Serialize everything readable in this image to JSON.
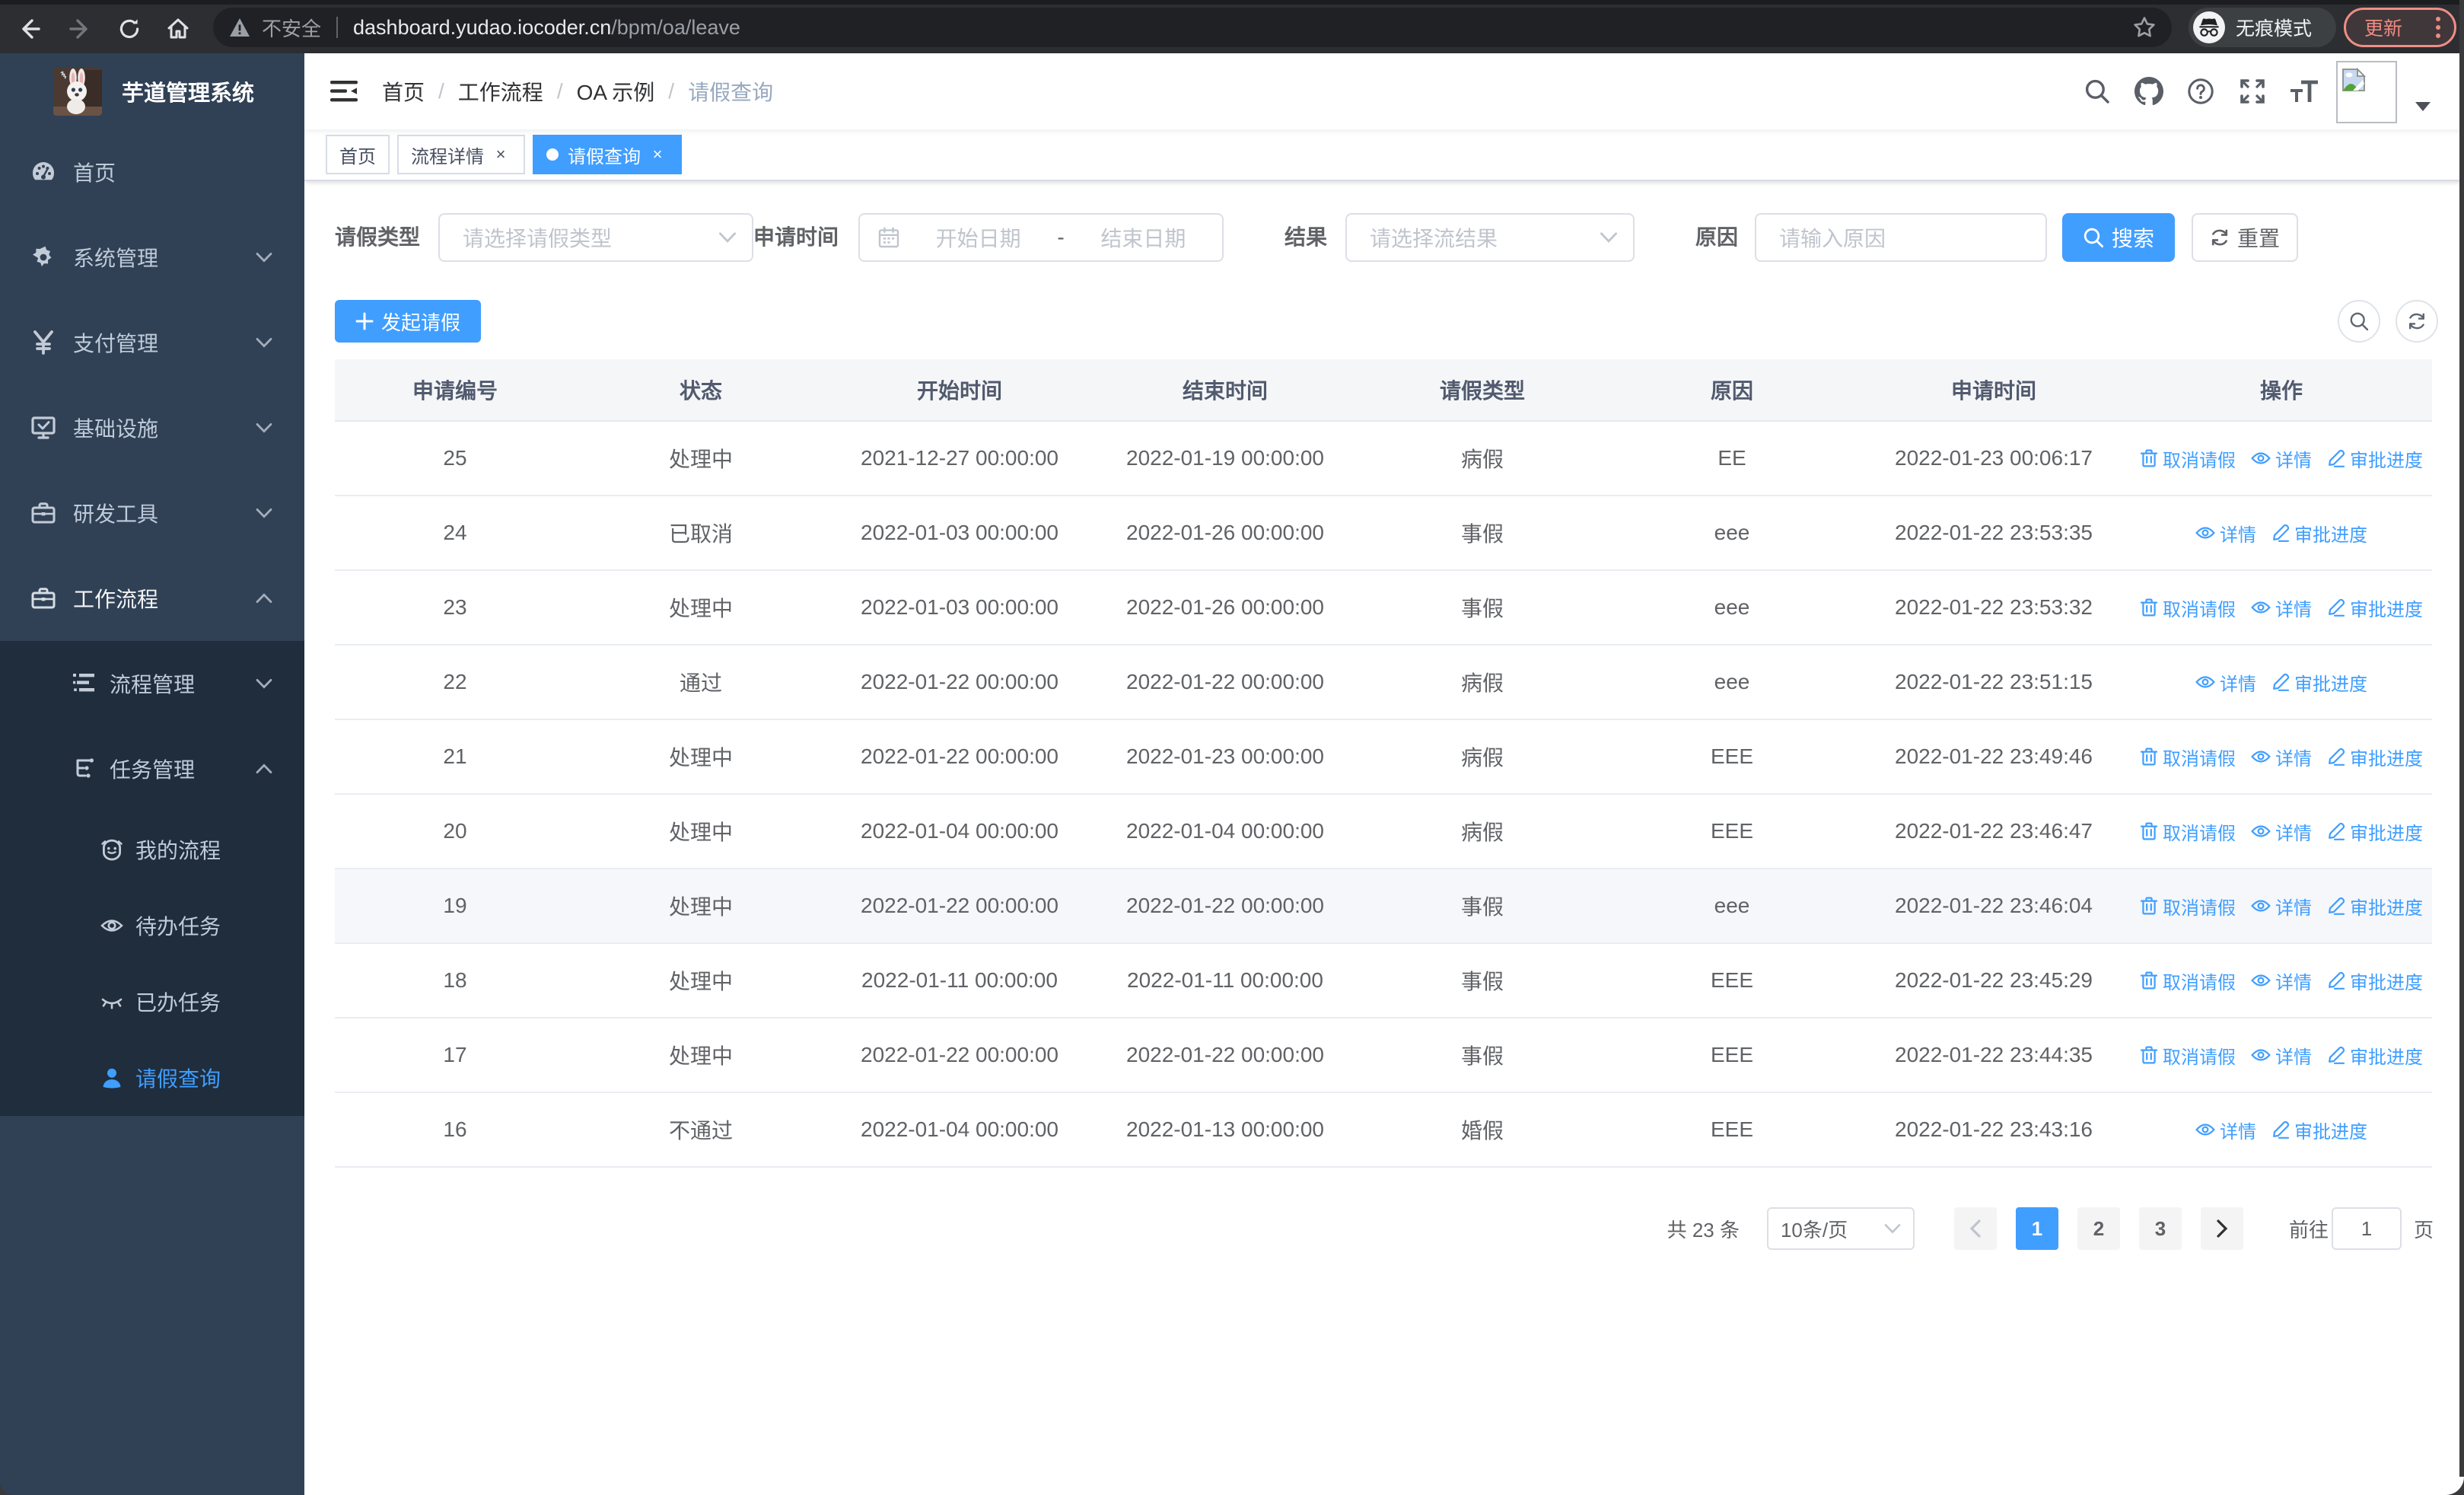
{
  "colors": {
    "accent": "#409eff",
    "sidebar_bg": "#304156",
    "submenu_bg": "#1f2d3d",
    "sidebar_text": "#bfcbd9",
    "chrome_bg": "#2d2e31",
    "omnibox_bg": "#202124",
    "update_accent": "#f08b82",
    "table_header_bg": "#f5f6f8",
    "hover_row_bg": "#f5f7fa"
  },
  "browser": {
    "security_label": "不安全",
    "url_host": "dashboard.yudao.iocoder.cn",
    "url_path": "/bpm/oa/leave",
    "incognito_label": "无痕模式",
    "update_label": "更新"
  },
  "sidebar": {
    "logo_title": "芋道管理系统",
    "menu": [
      {
        "label": "首页",
        "icon": "dashboard-icon"
      },
      {
        "label": "系统管理",
        "icon": "gear-icon"
      },
      {
        "label": "支付管理",
        "icon": "yen-icon"
      },
      {
        "label": "基础设施",
        "icon": "infrastructure-icon"
      },
      {
        "label": "研发工具",
        "icon": "toolbox-icon"
      },
      {
        "label": "工作流程",
        "icon": "workflow-icon"
      }
    ],
    "submenu": [
      {
        "label": "流程管理",
        "icon": "process-list-icon"
      },
      {
        "label": "任务管理",
        "icon": "task-tree-icon"
      }
    ],
    "task_children": [
      {
        "label": "我的流程",
        "icon": "robot-icon"
      },
      {
        "label": "待办任务",
        "icon": "eye-open-icon"
      },
      {
        "label": "已办任务",
        "icon": "eye-closed-icon"
      },
      {
        "label": "请假查询",
        "icon": "people-icon"
      }
    ],
    "active_item": "请假查询"
  },
  "navbar": {
    "breadcrumb": [
      "首页",
      "工作流程",
      "OA 示例",
      "请假查询"
    ],
    "separator": "/"
  },
  "tags": [
    {
      "label": "首页"
    },
    {
      "label": "流程详情",
      "close": "×"
    },
    {
      "label": "请假查询",
      "close": "×"
    }
  ],
  "active_tag": "请假查询",
  "filter": {
    "leave_type_label": "请假类型",
    "leave_type_placeholder": "请选择请假类型",
    "apply_time_label": "申请时间",
    "date_start_placeholder": "开始日期",
    "date_separator": "-",
    "date_end_placeholder": "结束日期",
    "result_label": "结果",
    "result_placeholder": "请选择流结果",
    "reason_label": "原因",
    "reason_placeholder": "请输入原因",
    "search_label": "搜索",
    "reset_label": "重置",
    "create_label": "发起请假"
  },
  "table": {
    "columns": [
      "申请编号",
      "状态",
      "开始时间",
      "结束时间",
      "请假类型",
      "原因",
      "申请时间",
      "操作"
    ],
    "ops": {
      "cancel": "取消请假",
      "detail": "详情",
      "progress": "审批进度"
    },
    "hovered_row_id": "19",
    "rows": [
      {
        "id": "25",
        "status": "处理中",
        "start": "2021-12-27 00:00:00",
        "end": "2022-01-19 00:00:00",
        "type": "病假",
        "reason": "EE",
        "applied": "2022-01-23 00:06:17",
        "can_cancel": true
      },
      {
        "id": "24",
        "status": "已取消",
        "start": "2022-01-03 00:00:00",
        "end": "2022-01-26 00:00:00",
        "type": "事假",
        "reason": "eee",
        "applied": "2022-01-22 23:53:35",
        "can_cancel": false
      },
      {
        "id": "23",
        "status": "处理中",
        "start": "2022-01-03 00:00:00",
        "end": "2022-01-26 00:00:00",
        "type": "事假",
        "reason": "eee",
        "applied": "2022-01-22 23:53:32",
        "can_cancel": true
      },
      {
        "id": "22",
        "status": "通过",
        "start": "2022-01-22 00:00:00",
        "end": "2022-01-22 00:00:00",
        "type": "病假",
        "reason": "eee",
        "applied": "2022-01-22 23:51:15",
        "can_cancel": false
      },
      {
        "id": "21",
        "status": "处理中",
        "start": "2022-01-22 00:00:00",
        "end": "2022-01-23 00:00:00",
        "type": "病假",
        "reason": "EEE",
        "applied": "2022-01-22 23:49:46",
        "can_cancel": true
      },
      {
        "id": "20",
        "status": "处理中",
        "start": "2022-01-04 00:00:00",
        "end": "2022-01-04 00:00:00",
        "type": "病假",
        "reason": "EEE",
        "applied": "2022-01-22 23:46:47",
        "can_cancel": true
      },
      {
        "id": "19",
        "status": "处理中",
        "start": "2022-01-22 00:00:00",
        "end": "2022-01-22 00:00:00",
        "type": "事假",
        "reason": "eee",
        "applied": "2022-01-22 23:46:04",
        "can_cancel": true
      },
      {
        "id": "18",
        "status": "处理中",
        "start": "2022-01-11 00:00:00",
        "end": "2022-01-11 00:00:00",
        "type": "事假",
        "reason": "EEE",
        "applied": "2022-01-22 23:45:29",
        "can_cancel": true
      },
      {
        "id": "17",
        "status": "处理中",
        "start": "2022-01-22 00:00:00",
        "end": "2022-01-22 00:00:00",
        "type": "事假",
        "reason": "EEE",
        "applied": "2022-01-22 23:44:35",
        "can_cancel": true
      },
      {
        "id": "16",
        "status": "不通过",
        "start": "2022-01-04 00:00:00",
        "end": "2022-01-13 00:00:00",
        "type": "婚假",
        "reason": "EEE",
        "applied": "2022-01-22 23:43:16",
        "can_cancel": false
      }
    ]
  },
  "pagination": {
    "total": "共 23 条",
    "page_size": "10条/页",
    "pages": [
      "1",
      "2",
      "3"
    ],
    "active_page": "1",
    "goto_label": "前往",
    "goto_value": "1",
    "page_unit": "页"
  }
}
